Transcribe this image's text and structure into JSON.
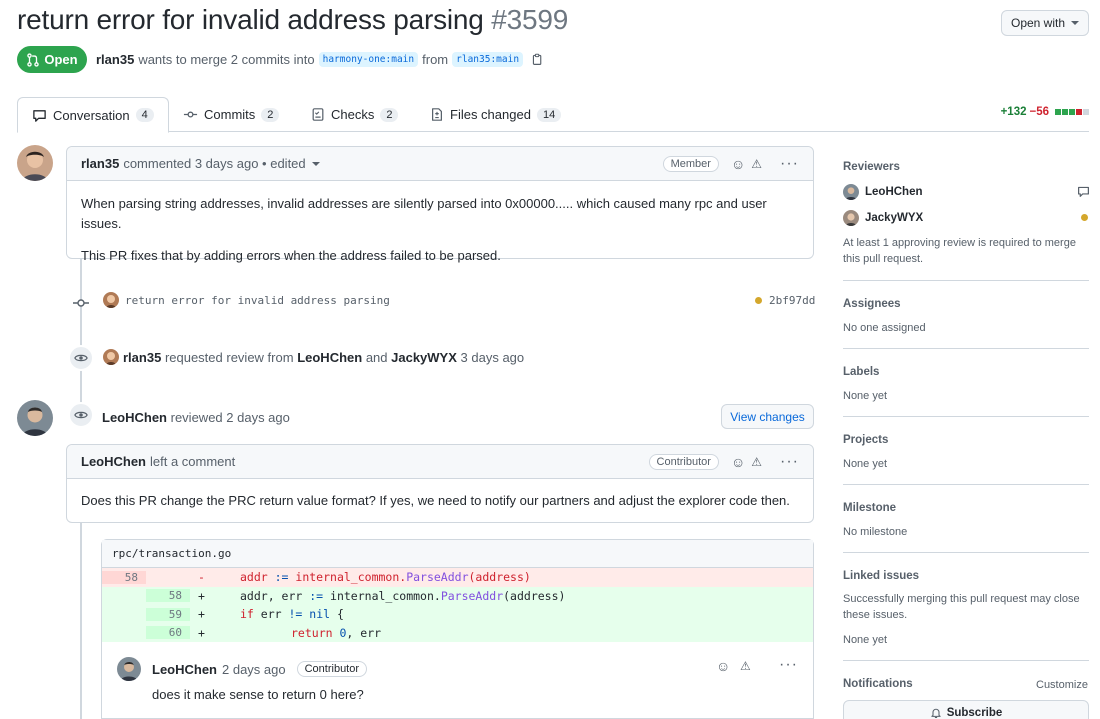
{
  "header": {
    "title": "return error for invalid address parsing",
    "number": "#3599",
    "open_with_label": "Open with",
    "state_label": "Open",
    "author": "rlan35",
    "merge_text": "wants to merge 2 commits into",
    "base_branch": "harmony-one:main",
    "from_text": "from",
    "head_branch": "rlan35:main"
  },
  "tabs": [
    {
      "label": "Conversation",
      "count": "4"
    },
    {
      "label": "Commits",
      "count": "2"
    },
    {
      "label": "Checks",
      "count": "2"
    },
    {
      "label": "Files changed",
      "count": "14"
    }
  ],
  "diffstat": {
    "additions": "+132",
    "deletions": "−56"
  },
  "comment1": {
    "author": "rlan35",
    "meta": "commented 3 days ago • edited",
    "badge": "Member",
    "para1": "When parsing string addresses, invalid addresses are silently parsed into 0x00000..... which caused many rpc and user issues.",
    "para2": "This PR fixes that by adding errors when the address failed to be parsed."
  },
  "commit": {
    "message": "return error for invalid address parsing",
    "sha": "2bf97dd"
  },
  "review_request": {
    "author": "rlan35",
    "text1": "requested review from",
    "reviewer1": "LeoHChen",
    "and_text": "and",
    "reviewer2": "JackyWYX",
    "time": "3 days ago"
  },
  "review": {
    "author": "LeoHChen",
    "text": "reviewed 2 days ago",
    "button": "View changes"
  },
  "comment2": {
    "author": "LeoHChen",
    "meta": "left a comment",
    "badge": "Contributor",
    "body": "Does this PR change the PRC return value format? If yes, we need to notify our partners and adjust the explorer code then."
  },
  "diff": {
    "file": "rpc/transaction.go",
    "lines": [
      {
        "type": "del",
        "old": "58",
        "new": "",
        "sign": "-"
      },
      {
        "type": "add",
        "old": "",
        "new": "58",
        "sign": "+"
      },
      {
        "type": "add",
        "old": "",
        "new": "59",
        "sign": "+"
      },
      {
        "type": "add",
        "old": "",
        "new": "60",
        "sign": "+"
      }
    ],
    "code": {
      "l1_a": "addr ",
      "l1_op": ":=",
      "l1_b": " internal_common.",
      "l1_fn": "ParseAddr",
      "l1_c": "(address)",
      "l2_a": "addr, err ",
      "l2_op": ":=",
      "l2_b": " internal_common.",
      "l2_fn": "ParseAddr",
      "l2_c": "(address)",
      "l3_kw": "if",
      "l3_a": " err ",
      "l3_op": "!=",
      "l3_sp": " ",
      "l3_nil": "nil",
      "l3_b": " {",
      "l4_kw": "return",
      "l4_sp": " ",
      "l4_zero": "0",
      "l4_b": ", err"
    }
  },
  "reply": {
    "author": "LeoHChen",
    "time": "2 days ago",
    "badge": "Contributor",
    "body": "does it make sense to return 0 here?"
  },
  "sidebar": {
    "reviewers_title": "Reviewers",
    "reviewer1": "LeoHChen",
    "reviewer2": "JackyWYX",
    "review_note": "At least 1 approving review is required to merge this pull request.",
    "assignees_title": "Assignees",
    "assignees_value": "No one assigned",
    "labels_title": "Labels",
    "labels_value": "None yet",
    "projects_title": "Projects",
    "projects_value": "None yet",
    "milestone_title": "Milestone",
    "milestone_value": "No milestone",
    "linked_title": "Linked issues",
    "linked_note": "Successfully merging this pull request may close these issues.",
    "linked_value": "None yet",
    "notifications_title": "Notifications",
    "customize_label": "Customize",
    "subscribe_label": "Subscribe"
  },
  "colors": {
    "open": "#2da44e",
    "add": "#1a7f37",
    "del": "#cf222e",
    "link": "#0969da"
  }
}
